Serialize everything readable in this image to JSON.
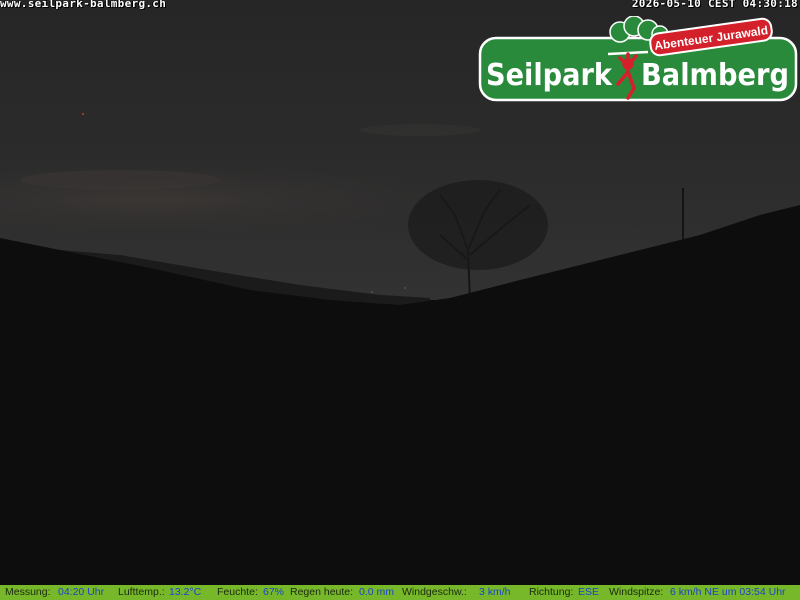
{
  "overlay": {
    "url": "www.seilpark-balmberg.ch",
    "timestamp": "2026-05-10 CEST 04:30:18"
  },
  "logo": {
    "name": "Seilpark Balmberg",
    "banner": "Abenteuer Jurawald"
  },
  "weather": {
    "measurement_label": "Messung:",
    "measurement_value": "04:20 Uhr",
    "temp_label": "Lufttemp.:",
    "temp_value": "13.2°C",
    "humidity_label": "Feuchte:",
    "humidity_value": "67%",
    "rain_label": "Regen heute:",
    "rain_value": "0.0 mm",
    "wind_label": "Windgeschw.:",
    "wind_value": "3 km/h",
    "direction_label": "Richtung:",
    "direction_value": "ESE",
    "gust_label": "Windspitze:",
    "gust_value": "6 km/h NE um 03:54 Uhr"
  },
  "colors": {
    "bar_background": "#76b82a",
    "value_text": "#1a44c8",
    "logo_green": "#2a8a3c",
    "banner_red": "#d4202a"
  }
}
